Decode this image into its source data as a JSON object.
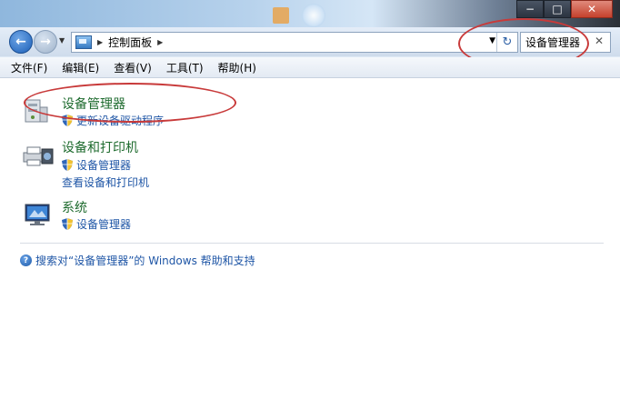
{
  "caption": {
    "minimize": "−",
    "maximize": "□",
    "close": "✕"
  },
  "nav": {
    "back_glyph": "←",
    "forward_glyph": "→",
    "recent_glyph": "▼"
  },
  "address": {
    "sep_glyph": "▶",
    "breadcrumb": "控制面板",
    "dropdown_glyph": "▼",
    "refresh_glyph": "↻"
  },
  "search": {
    "value": "设备管理器",
    "clear_glyph": "✕"
  },
  "menu": [
    "文件(F)",
    "编辑(E)",
    "查看(V)",
    "工具(T)",
    "帮助(H)"
  ],
  "results": [
    {
      "title": "设备管理器",
      "links": [
        "更新设备驱动程序"
      ],
      "icon": "device-manager-icon"
    },
    {
      "title": "设备和打印机",
      "links": [
        "设备管理器",
        "查看设备和打印机"
      ],
      "icon": "printer-icon"
    },
    {
      "title": "系统",
      "links": [
        "设备管理器"
      ],
      "icon": "system-computer-icon"
    }
  ],
  "help": {
    "glyph": "?",
    "text": "搜索对“设备管理器”的 Windows 帮助和支持"
  },
  "colors": {
    "accent_link": "#1f56a6",
    "title_green": "#1e6b2e",
    "annotation_red": "#c83a3a"
  }
}
